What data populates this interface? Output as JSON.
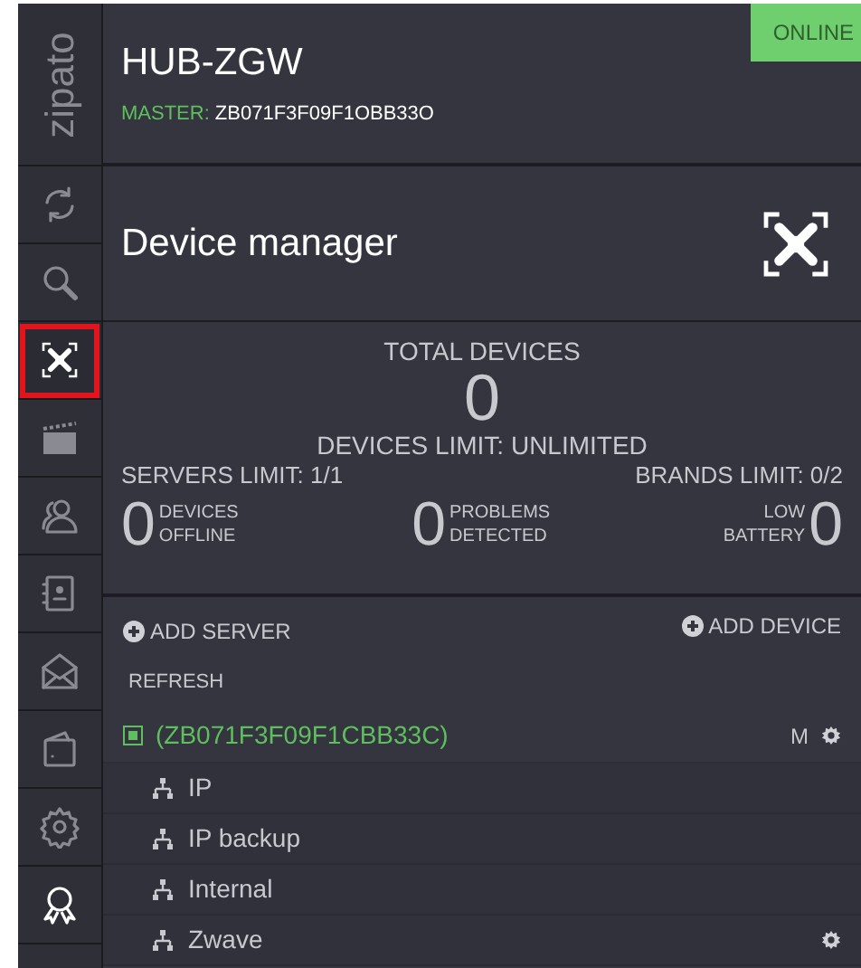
{
  "sidebar": {
    "logo": "zipato",
    "items": [
      {
        "selected": false
      },
      {
        "selected": false
      },
      {
        "selected": true
      },
      {
        "selected": false
      },
      {
        "selected": false
      },
      {
        "selected": false
      },
      {
        "selected": false
      },
      {
        "selected": false
      },
      {
        "selected": false
      },
      {
        "selected": false
      }
    ]
  },
  "header": {
    "title": "HUB-ZGW",
    "master_label": "MASTER:",
    "master_value": "ZB071F3F09F1OBB33O",
    "status": "ONLINE"
  },
  "page": {
    "title": "Device manager"
  },
  "stats": {
    "total_label": "TOTAL DEVICES",
    "total_value": "0",
    "devices_limit": "DEVICES LIMIT: UNLIMITED",
    "servers_limit": "SERVERS LIMIT: 1/1",
    "brands_limit": "BRANDS LIMIT: 0/2",
    "counters": [
      {
        "value": "0",
        "label_1": "DEVICES",
        "label_2": "OFFLINE"
      },
      {
        "value": "0",
        "label_1": "PROBLEMS",
        "label_2": "DETECTED"
      },
      {
        "value": "0",
        "label_1": "LOW",
        "label_2": "BATTERY"
      }
    ]
  },
  "actions": {
    "add_server": "ADD SERVER",
    "add_device": "ADD DEVICE",
    "refresh": "REFRESH"
  },
  "tree": [
    {
      "label": "(ZB071F3F09F1CBB33C)",
      "badge": "M",
      "settings": true,
      "children": [
        {
          "label": "IP",
          "settings": false
        },
        {
          "label": "IP backup",
          "settings": false
        },
        {
          "label": "Internal",
          "settings": false
        },
        {
          "label": "Zwave",
          "settings": true
        }
      ]
    }
  ]
}
